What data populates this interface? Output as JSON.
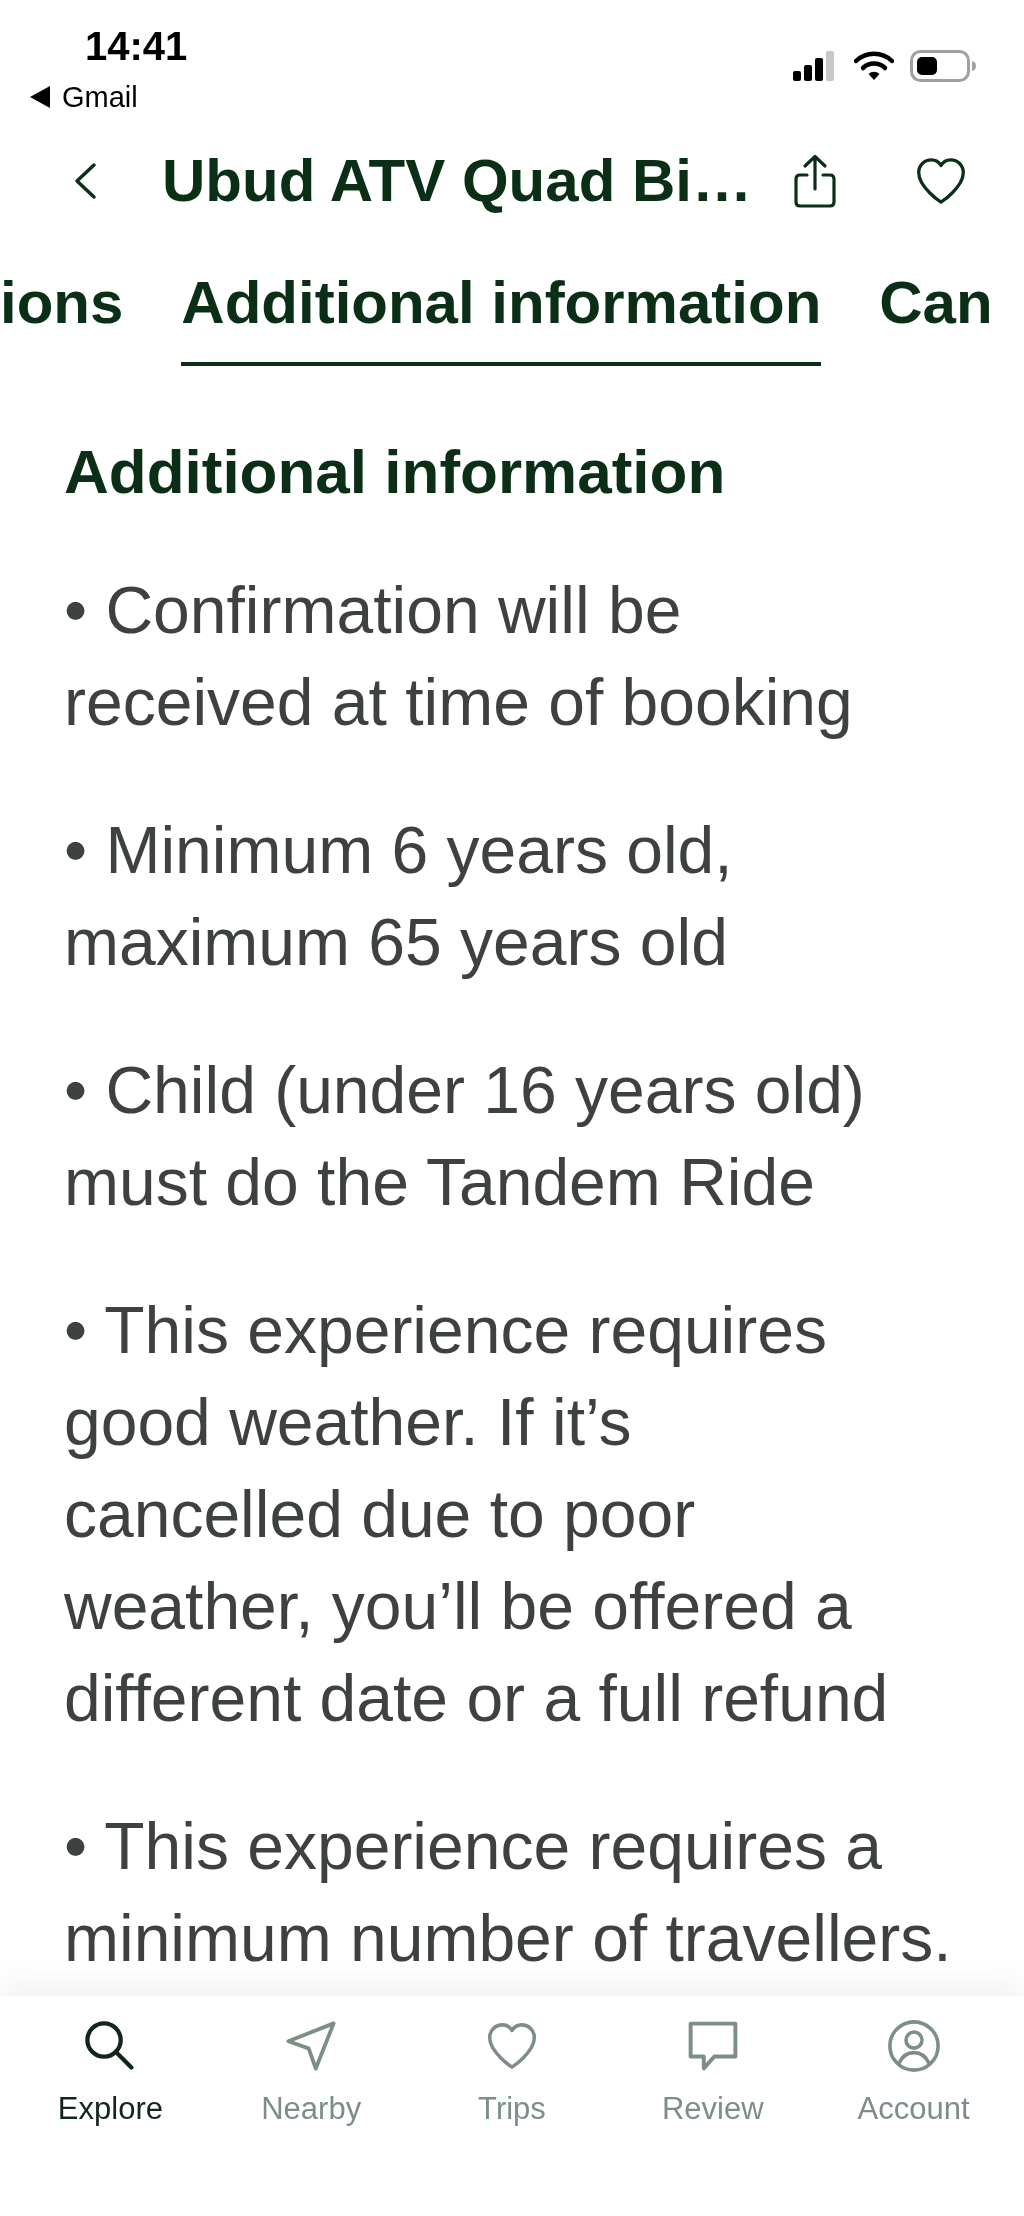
{
  "status_bar": {
    "time": "14:41",
    "back_app": "Gmail"
  },
  "header": {
    "title": "Ubud ATV Quad Bi…"
  },
  "tabs": [
    {
      "label": "ions",
      "selected": false
    },
    {
      "label": "Additional information",
      "selected": true
    },
    {
      "label": "Can",
      "selected": false
    }
  ],
  "section": {
    "heading": "Additional information",
    "items": [
      "• Confirmation will be\nreceived at time of booking",
      "• Minimum 6 years old,\nmaximum 65 years old",
      "• Child (under 16 years old)\nmust do the Tandem Ride",
      "• This experience requires\ngood weather. If it’s\ncancelled due to poor\nweather, you’ll be offered a\ndifferent date or a full refund",
      "• This experience requires a\nminimum number of travellers."
    ]
  },
  "bottom_nav": [
    {
      "kind": "explore",
      "label": "Explore",
      "selected": true
    },
    {
      "kind": "nearby",
      "label": "Nearby",
      "selected": false
    },
    {
      "kind": "trips",
      "label": "Trips",
      "selected": false
    },
    {
      "kind": "review",
      "label": "Review",
      "selected": false
    },
    {
      "kind": "account",
      "label": "Account",
      "selected": false
    }
  ]
}
